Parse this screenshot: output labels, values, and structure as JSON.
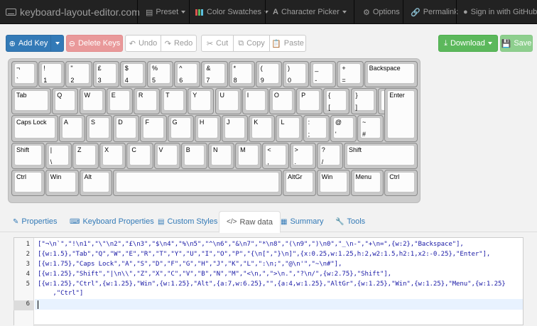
{
  "navbar": {
    "brand": "keyboard-layout-editor.com",
    "preset": "Preset",
    "color_swatches": "Color Swatches",
    "character_picker": "Character Picker",
    "options": "Options",
    "permalink": "Permalink",
    "sign_in": "Sign in with GitHub"
  },
  "toolbar": {
    "add_key": "Add Key",
    "delete_keys": "Delete Keys",
    "undo": "Undo",
    "redo": "Redo",
    "cut": "Cut",
    "copy": "Copy",
    "paste": "Paste",
    "download": "Download",
    "save": "Save"
  },
  "keyboard": {
    "keys": [
      {
        "top": "¬",
        "bottom": "`"
      },
      {
        "top": "!",
        "bottom": "1"
      },
      {
        "top": "\"",
        "bottom": "2"
      },
      {
        "top": "£",
        "bottom": "3"
      },
      {
        "top": "$",
        "bottom": "4"
      },
      {
        "top": "%",
        "bottom": "5"
      },
      {
        "top": "^",
        "bottom": "6"
      },
      {
        "top": "&",
        "bottom": "7"
      },
      {
        "top": "*",
        "bottom": "8"
      },
      {
        "top": "(",
        "bottom": "9"
      },
      {
        "top": ")",
        "bottom": "0"
      },
      {
        "top": "_",
        "bottom": "-"
      },
      {
        "top": "+",
        "bottom": "="
      },
      {
        "top": "Backspace",
        "bottom": ""
      },
      {
        "top": "Tab",
        "bottom": ""
      },
      {
        "top": "Q",
        "bottom": ""
      },
      {
        "top": "W",
        "bottom": ""
      },
      {
        "top": "E",
        "bottom": ""
      },
      {
        "top": "R",
        "bottom": ""
      },
      {
        "top": "T",
        "bottom": ""
      },
      {
        "top": "Y",
        "bottom": ""
      },
      {
        "top": "U",
        "bottom": ""
      },
      {
        "top": "I",
        "bottom": ""
      },
      {
        "top": "O",
        "bottom": ""
      },
      {
        "top": "P",
        "bottom": ""
      },
      {
        "top": "{",
        "bottom": "["
      },
      {
        "top": "}",
        "bottom": "]"
      },
      {
        "top": "Enter",
        "bottom": ""
      },
      {
        "top": "Caps Lock",
        "bottom": ""
      },
      {
        "top": "A",
        "bottom": ""
      },
      {
        "top": "S",
        "bottom": ""
      },
      {
        "top": "D",
        "bottom": ""
      },
      {
        "top": "F",
        "bottom": ""
      },
      {
        "top": "G",
        "bottom": ""
      },
      {
        "top": "H",
        "bottom": ""
      },
      {
        "top": "J",
        "bottom": ""
      },
      {
        "top": "K",
        "bottom": ""
      },
      {
        "top": "L",
        "bottom": ""
      },
      {
        "top": ":",
        "bottom": ";"
      },
      {
        "top": "@",
        "bottom": "'"
      },
      {
        "top": "~",
        "bottom": "#"
      },
      {
        "top": "Shift",
        "bottom": ""
      },
      {
        "top": "|",
        "bottom": "\\"
      },
      {
        "top": "Z",
        "bottom": ""
      },
      {
        "top": "X",
        "bottom": ""
      },
      {
        "top": "C",
        "bottom": ""
      },
      {
        "top": "V",
        "bottom": ""
      },
      {
        "top": "B",
        "bottom": ""
      },
      {
        "top": "N",
        "bottom": ""
      },
      {
        "top": "M",
        "bottom": ""
      },
      {
        "top": "<",
        "bottom": ","
      },
      {
        "top": ">",
        "bottom": "."
      },
      {
        "top": "?",
        "bottom": "/"
      },
      {
        "top": "Shift",
        "bottom": ""
      },
      {
        "top": "Ctrl",
        "bottom": ""
      },
      {
        "top": "Win",
        "bottom": ""
      },
      {
        "top": "Alt",
        "bottom": ""
      },
      {
        "top": "",
        "bottom": ""
      },
      {
        "top": "AltGr",
        "bottom": ""
      },
      {
        "top": "Win",
        "bottom": ""
      },
      {
        "top": "Menu",
        "bottom": ""
      },
      {
        "top": "Ctrl",
        "bottom": ""
      }
    ]
  },
  "tabs": [
    {
      "label": "Properties",
      "active": false
    },
    {
      "label": "Keyboard Properties",
      "active": false
    },
    {
      "label": "Custom Styles",
      "active": false
    },
    {
      "label": "Raw data",
      "active": true
    },
    {
      "label": "Summary",
      "active": false
    },
    {
      "label": "Tools",
      "active": false
    }
  ],
  "editor": {
    "line_numbers": [
      "1",
      "2",
      "3",
      "4",
      "5",
      "",
      "6"
    ],
    "lines": [
      "[\"¬\\n`\",\"!\\n1\",\"\\\"\\n2\",\"£\\n3\",\"$\\n4\",\"%\\n5\",\"^\\n6\",\"&\\n7\",\"*\\n8\",\"(\\n9\",\")\\n0\",\"_\\n-\",\"+\\n=\",{w:2},\"Backspace\"],",
      "[{w:1.5},\"Tab\",\"Q\",\"W\",\"E\",\"R\",\"T\",\"Y\",\"U\",\"I\",\"O\",\"P\",\"{\\n[\",\"}\\n]\",{x:0.25,w:1.25,h:2,w2:1.5,h2:1,x2:-0.25},\"Enter\"],",
      "[{w:1.75},\"Caps Lock\",\"A\",\"S\",\"D\",\"F\",\"G\",\"H\",\"J\",\"K\",\"L\",\":\\n;\",\"@\\n'\",\"~\\n#\"],",
      "[{w:1.25},\"Shift\",\"|\\n\\\\\",\"Z\",\"X\",\"C\",\"V\",\"B\",\"N\",\"M\",\"<\\n,\",\">\\n.\",\"?\\n/\",{w:2.75},\"Shift\"],",
      "[{w:1.25},\"Ctrl\",{w:1.25},\"Win\",{w:1.25},\"Alt\",{a:7,w:6.25},\"\",{a:4,w:1.25},\"AltGr\",{w:1.25},\"Win\",{w:1.25},\"Menu\",{w:1.25}",
      "    ,\"Ctrl\"]",
      ""
    ]
  },
  "colors": {
    "navbar_bg": "#222222",
    "primary": "#337ab7",
    "danger": "#e9999a",
    "success": "#5cb85c",
    "keycap": "#fcfcfc",
    "keyboard_bg": "#cccccc"
  }
}
